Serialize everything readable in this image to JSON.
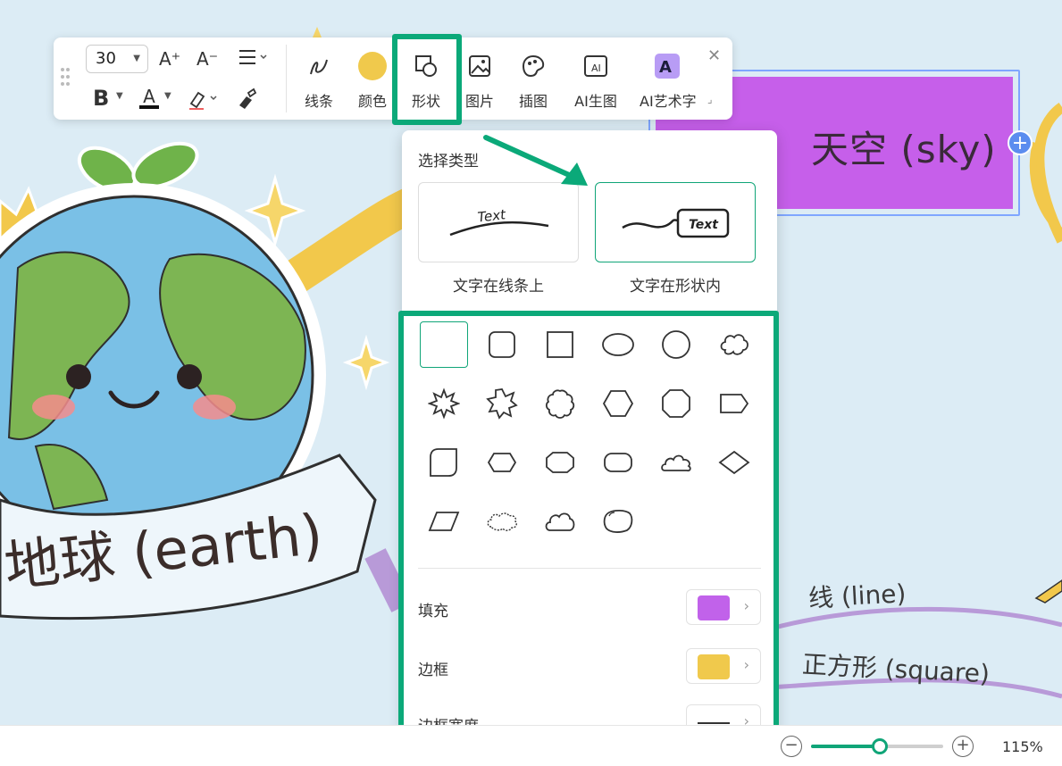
{
  "colors": {
    "accent": "#10a578",
    "highlight": "#0ba979",
    "fill": "#c162ea",
    "border": "#f0c94c",
    "node_fill": "#c65fea",
    "canvas_bg": "#dcecf5"
  },
  "canvas": {
    "node_sky_text": "天空 (sky)",
    "label_earth": "地球 (earth)",
    "label_line": "线 (line)",
    "label_square": "正方形 (square)"
  },
  "toolbar": {
    "font_size_value": "30",
    "increase_font": "A⁺",
    "decrease_font": "A⁻",
    "bold": "B",
    "font_color": "A",
    "buttons": [
      {
        "label": "线条",
        "icon": "line-style-icon"
      },
      {
        "label": "颜色",
        "icon": "color-dot-icon"
      },
      {
        "label": "形状",
        "icon": "shape-icon"
      },
      {
        "label": "图片",
        "icon": "image-icon"
      },
      {
        "label": "插图",
        "icon": "illustration-icon"
      },
      {
        "label": "AI生图",
        "icon": "ai-image-icon"
      },
      {
        "label": "AI艺术字",
        "icon": "ai-art-text-icon"
      }
    ]
  },
  "shape_panel": {
    "title": "选择类型",
    "types": [
      {
        "label": "文字在线条上",
        "preview_text": "Text",
        "selected": false
      },
      {
        "label": "文字在形状内",
        "preview_text": "Text",
        "selected": true
      }
    ],
    "shapes": [
      "none",
      "rounded-rectangle",
      "square",
      "ellipse",
      "circle",
      "cloud",
      "burst-small",
      "burst-large",
      "scallop",
      "hexagon",
      "octagon",
      "pentagon-tag",
      "folded-square",
      "hexagon-wide",
      "octagon-wide",
      "stadium",
      "cloud-flat",
      "diamond",
      "parallelogram",
      "cloud-wide",
      "cloud-puffy",
      "blob"
    ],
    "selected_shape_index": 0,
    "fill_label": "填充",
    "border_label": "边框",
    "border_width_label": "边框宽度"
  },
  "statusbar": {
    "zoom_minus": "−",
    "zoom_plus": "+",
    "zoom_level": "115%",
    "zoom_fraction": 0.52
  }
}
